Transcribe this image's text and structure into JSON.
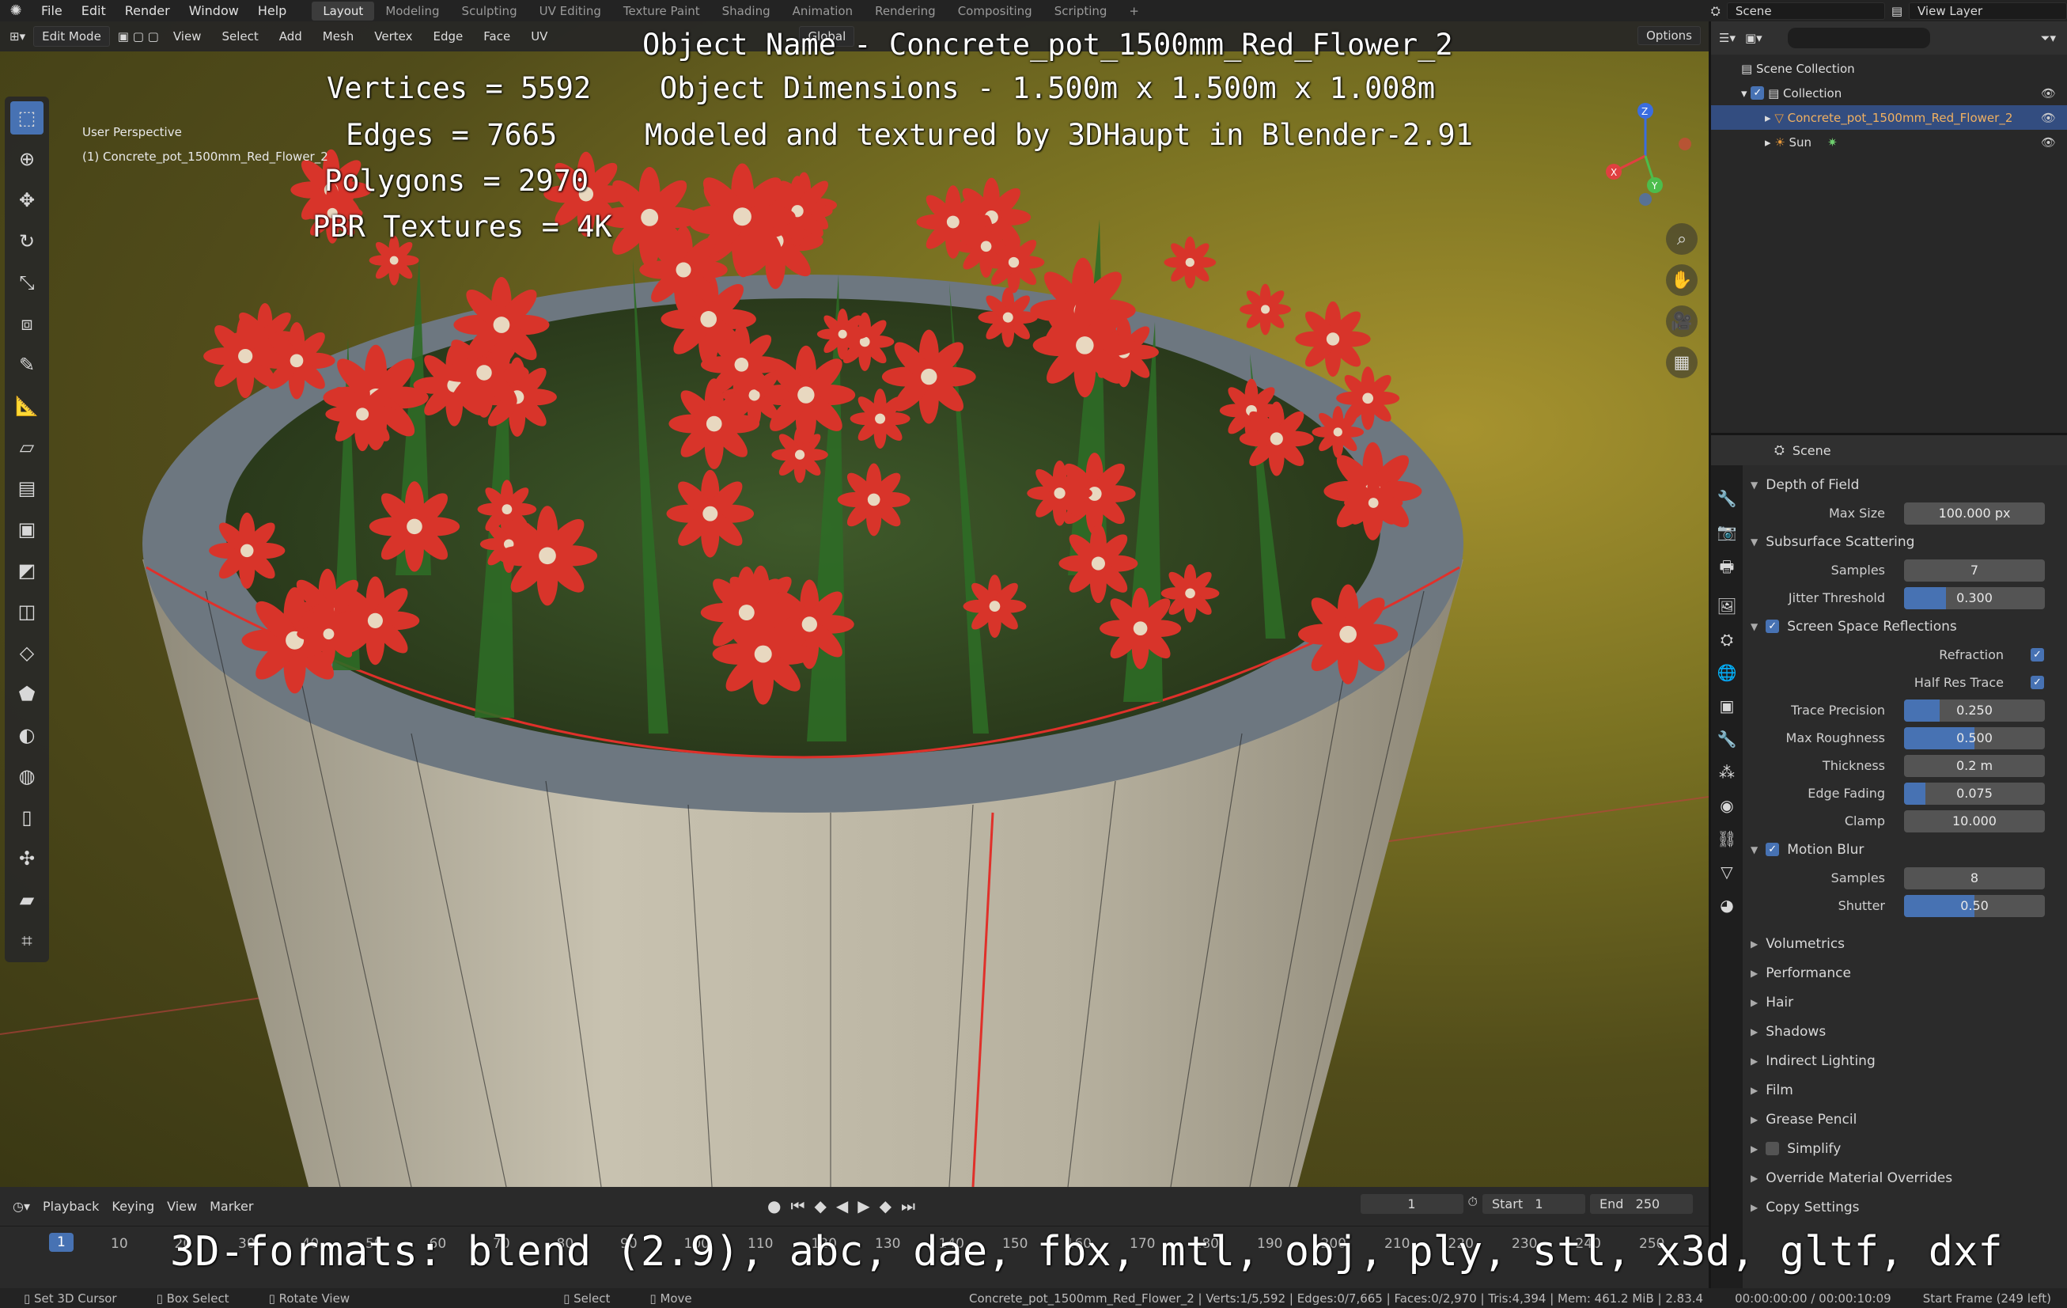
{
  "menu": {
    "items": [
      "File",
      "Edit",
      "Render",
      "Window",
      "Help"
    ],
    "workspaces": [
      "Layout",
      "Modeling",
      "Sculpting",
      "UV Editing",
      "Texture Paint",
      "Shading",
      "Animation",
      "Rendering",
      "Compositing",
      "Scripting"
    ],
    "active_workspace": "Layout",
    "scene": "Scene",
    "view_layer": "View Layer"
  },
  "viewport": {
    "mode": "Edit Mode",
    "menus": [
      "View",
      "Select",
      "Add",
      "Mesh",
      "Vertex",
      "Edge",
      "Face",
      "UV"
    ],
    "orientation": "Global",
    "options": "Options",
    "perspective": "User Perspective",
    "object_label": "(1) Concrete_pot_1500mm_Red_Flower_2"
  },
  "overlay": {
    "object_name": "Object Name - Concrete_pot_1500mm_Red_Flower_2",
    "object_dimensions": "Object Dimensions -  1.500m x 1.500m x 1.008m",
    "credit": "Modeled and textured by 3DHaupt in Blender-2.91",
    "vertices": "Vertices = 5592",
    "edges": "Edges = 7665",
    "polygons": "Polygons = 2970",
    "textures": "PBR Textures = 4K",
    "formats": "3D-formats: blend (2.9), abc, dae, fbx, mtl, obj, ply, stl, x3d, gltf, dxf"
  },
  "gizmo": {
    "z": "Z",
    "y": "Y",
    "x": "X"
  },
  "timeline": {
    "menus": [
      "Playback",
      "Keying",
      "View",
      "Marker"
    ],
    "current_frame": "1",
    "start_label": "Start",
    "start": "1",
    "end_label": "End",
    "end": "250",
    "ticks": [
      "10",
      "20",
      "30",
      "40",
      "50",
      "60",
      "70",
      "80",
      "90",
      "100",
      "110",
      "120",
      "130",
      "140",
      "150",
      "160",
      "170",
      "180",
      "190",
      "200",
      "210",
      "220",
      "230",
      "240",
      "250"
    ]
  },
  "statusbar": {
    "set_cursor": "Set 3D Cursor",
    "box_select": "Box Select",
    "rotate_view": "Rotate View",
    "select": "Select",
    "move": "Move",
    "stats": "Concrete_pot_1500mm_Red_Flower_2 | Verts:1/5,592 | Edges:0/7,665 | Faces:0/2,970 | Tris:4,394 | Mem: 461.2 MiB | 2.83.4",
    "time": "00:00:00:00 / 00:00:10:09",
    "start_frame": "Start Frame (249 left)"
  },
  "outliner": {
    "rows": [
      {
        "label": "Scene Collection"
      },
      {
        "label": "Collection"
      },
      {
        "label": "Concrete_pot_1500mm_Red_Flower_2"
      },
      {
        "label": "Sun"
      }
    ]
  },
  "properties": {
    "title": "Scene",
    "dof": {
      "label": "Depth of Field",
      "max_size_label": "Max Size",
      "max_size": "100.000 px"
    },
    "sss": {
      "label": "Subsurface Scattering",
      "samples_label": "Samples",
      "samples": "7",
      "jitter_label": "Jitter Threshold",
      "jitter": "0.300",
      "jitter_fraction": 0.3
    },
    "ssr": {
      "label": "Screen Space Reflections",
      "refraction_label": "Refraction",
      "halfres_label": "Half Res Trace",
      "trace_precision_label": "Trace Precision",
      "trace_precision": "0.250",
      "trace_precision_fraction": 0.25,
      "max_roughness_label": "Max Roughness",
      "max_roughness": "0.500",
      "max_roughness_fraction": 0.5,
      "thickness_label": "Thickness",
      "thickness": "0.2 m",
      "edge_fading_label": "Edge Fading",
      "edge_fading": "0.075",
      "edge_fading_fraction": 0.15,
      "clamp_label": "Clamp",
      "clamp": "10.000"
    },
    "motion_blur": {
      "label": "Motion Blur",
      "samples_label": "Samples",
      "samples": "8",
      "shutter_label": "Shutter",
      "shutter": "0.50",
      "shutter_fraction": 0.5
    },
    "collapsed": [
      "Volumetrics",
      "Performance",
      "Hair",
      "Shadows",
      "Indirect Lighting",
      "Film",
      "Grease Pencil",
      "Simplify",
      "Override Material Overrides",
      "Copy Settings"
    ]
  },
  "colors": {
    "accent": "#4772b3",
    "selected_row": "#334d80",
    "flower_red": "#d8342a",
    "edge_red": "#e0302a"
  }
}
